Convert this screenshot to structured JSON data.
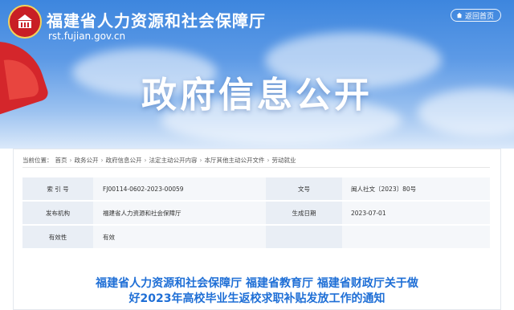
{
  "header": {
    "site_title": "福建省人力资源和社会保障厅",
    "site_domain": "rst.fujian.gov.cn",
    "home_button": "返回首页",
    "banner_title": "政府信息公开"
  },
  "breadcrumb": {
    "label": "当前位置：",
    "items": [
      "首页",
      "政务公开",
      "政府信息公开",
      "法定主动公开内容",
      "本厅其他主动公开文件",
      "劳动就业"
    ]
  },
  "info_table": {
    "rows": [
      {
        "label1": "索 引 号",
        "value1": "FJ00114-0602-2023-00059",
        "label2": "文号",
        "value2": "闽人社文〔2023〕80号"
      },
      {
        "label1": "发布机构",
        "value1": "福建省人力资源和社会保障厅",
        "label2": "生成日期",
        "value2": "2023-07-01"
      },
      {
        "label1": "有效性",
        "value1": "有效",
        "label2": "",
        "value2": ""
      }
    ]
  },
  "document": {
    "title_line1": "福建省人力资源和社会保障厅 福建省教育厅 福建省财政厅关于做",
    "title_line2": "好2023年高校毕业生返校求职补贴发放工作的通知"
  },
  "colors": {
    "banner_blue": "#3d86de",
    "title_blue": "#1f6fd6",
    "emblem_red": "#c81f25",
    "label_bg": "#e9eef5"
  }
}
